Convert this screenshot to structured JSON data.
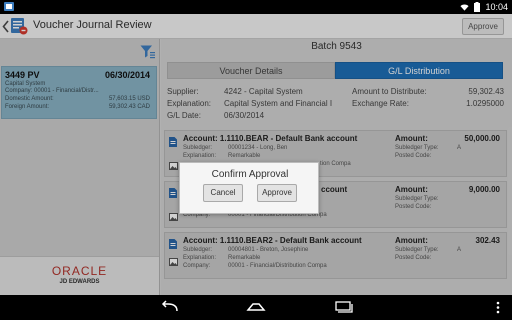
{
  "status_bar": {
    "time": "10:04",
    "icons": [
      "app-notification-icon",
      "wifi-icon",
      "battery-icon"
    ]
  },
  "app_bar": {
    "title": "Voucher Journal Review",
    "approve_label": "Approve",
    "icons": [
      "back-arrow-icon",
      "app-logo-icon"
    ]
  },
  "left_pane": {
    "filter_icon": "filter-icon",
    "voucher": {
      "number": "3449 PV",
      "date": "06/30/2014",
      "supplier": "Capital System",
      "company_label": "Company:",
      "company_value": "00001 - Financial/Distr...",
      "domestic_label": "Domestic Amount:",
      "domestic_value": "57,603.15 USD",
      "foreign_label": "Foreign Amount:",
      "foreign_value": "59,302.43 CAD"
    },
    "brand": {
      "oracle": "ORACLE",
      "jde": "JD EDWARDS"
    }
  },
  "main": {
    "batch_title": "Batch 9543",
    "tabs": [
      {
        "label": "Voucher Details",
        "active": false
      },
      {
        "label": "G/L Distribution",
        "active": true
      }
    ],
    "info": {
      "supplier_label": "Supplier:",
      "supplier_value": "4242 - Capital System",
      "explanation_label": "Explanation:",
      "explanation_value": "Capital System and Financial I",
      "gl_date_label": "G/L Date:",
      "gl_date_value": "06/30/2014",
      "amount_label": "Amount to Distribute:",
      "amount_value": "59,302.43",
      "exchange_label": "Exchange Rate:",
      "exchange_value": "1.0295000"
    },
    "entries": [
      {
        "account": "Account:  1.1110.BEAR - Default Bank account",
        "amount_label": "Amount:",
        "amount": "50,000.00",
        "subledger_label": "Subledger:",
        "subledger": "00001234 - Long, Ben",
        "explanation_label": "Explanation:",
        "explanation": "Remarkable",
        "company_label": "",
        "company": "tion Compa",
        "subledger_type_label": "Subledger Type:",
        "subledger_type": "A",
        "posted_code_label": "Posted Code:",
        "posted_code": ""
      },
      {
        "account": "ccount",
        "amount_label": "Amount:",
        "amount": "9,000.00",
        "subledger_label": "",
        "subledger": "",
        "explanation_label": "",
        "explanation": "",
        "company_label": "Company:",
        "company": "00001 - Financial/Distribution Compa",
        "subledger_type_label": "Subledger Type:",
        "subledger_type": "",
        "posted_code_label": "Posted Code:",
        "posted_code": ""
      },
      {
        "account": "Account:  1.1110.BEAR2 - Default Bank account",
        "amount_label": "Amount:",
        "amount": "302.43",
        "subledger_label": "Subledger:",
        "subledger": "00004801 - Breton, Josephine",
        "explanation_label": "Explanation:",
        "explanation": "Remarkable",
        "company_label": "Company:",
        "company": "00001 - Financial/Distribution Compa",
        "subledger_type_label": "Subledger Type:",
        "subledger_type": "A",
        "posted_code_label": "Posted Code:",
        "posted_code": ""
      }
    ]
  },
  "dialog": {
    "title": "Confirm Approval",
    "cancel_label": "Cancel",
    "approve_label": "Approve"
  },
  "nav_bar": {
    "icons": [
      "nav-back-icon",
      "nav-home-icon",
      "nav-recent-apps-icon",
      "overflow-menu-icon"
    ]
  },
  "colors": {
    "accent": "#1e6fb8",
    "selected_card": "#8ab4c6",
    "oracle_red": "#b3322b"
  }
}
